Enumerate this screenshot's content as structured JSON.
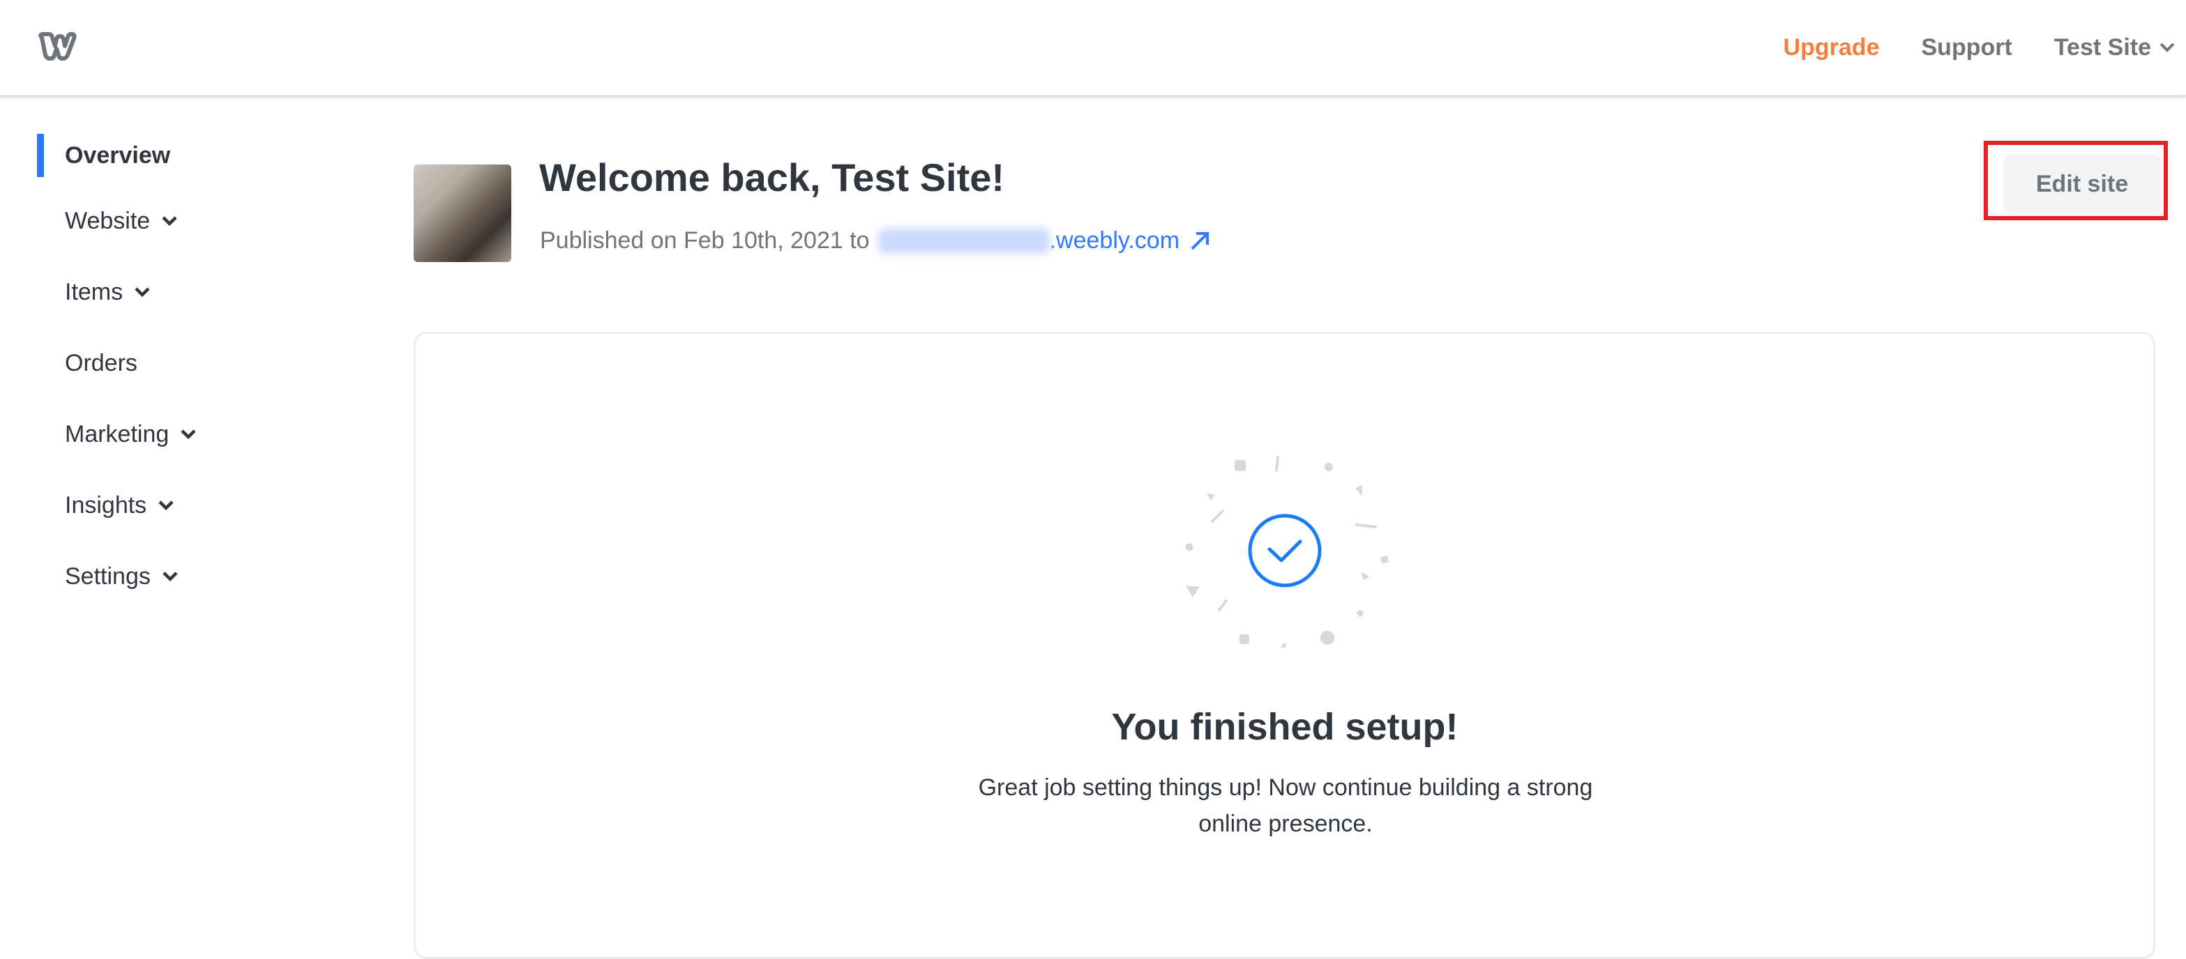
{
  "header": {
    "logo_icon": "weebly-w-logo",
    "upgrade_label": "Upgrade",
    "support_label": "Support",
    "site_menu_label": "Test Site",
    "colors": {
      "upgrade": "#f57e3c",
      "nav_text": "#6f747a"
    }
  },
  "sidebar": {
    "items": [
      {
        "label": "Overview",
        "active": true,
        "has_chevron": false
      },
      {
        "label": "Website",
        "active": false,
        "has_chevron": true
      },
      {
        "label": "Items",
        "active": false,
        "has_chevron": true
      },
      {
        "label": "Orders",
        "active": false,
        "has_chevron": false
      },
      {
        "label": "Marketing",
        "active": false,
        "has_chevron": true
      },
      {
        "label": "Insights",
        "active": false,
        "has_chevron": true
      },
      {
        "label": "Settings",
        "active": false,
        "has_chevron": true
      }
    ],
    "active_color": "#2f77ff"
  },
  "welcome": {
    "title": "Welcome back, Test Site!",
    "published_prefix": "Published on Feb 10th, 2021 to",
    "domain_suffix": ".weebly.com",
    "link_color": "#2f77ff"
  },
  "actions": {
    "edit_site_label": "Edit site",
    "highlight_color": "#e32127"
  },
  "setup_card": {
    "icon": "check-circle-icon",
    "title": "You finished setup!",
    "text": "Great job setting things up! Now continue building a strong online presence.",
    "accent_color": "#1a7cf5"
  }
}
